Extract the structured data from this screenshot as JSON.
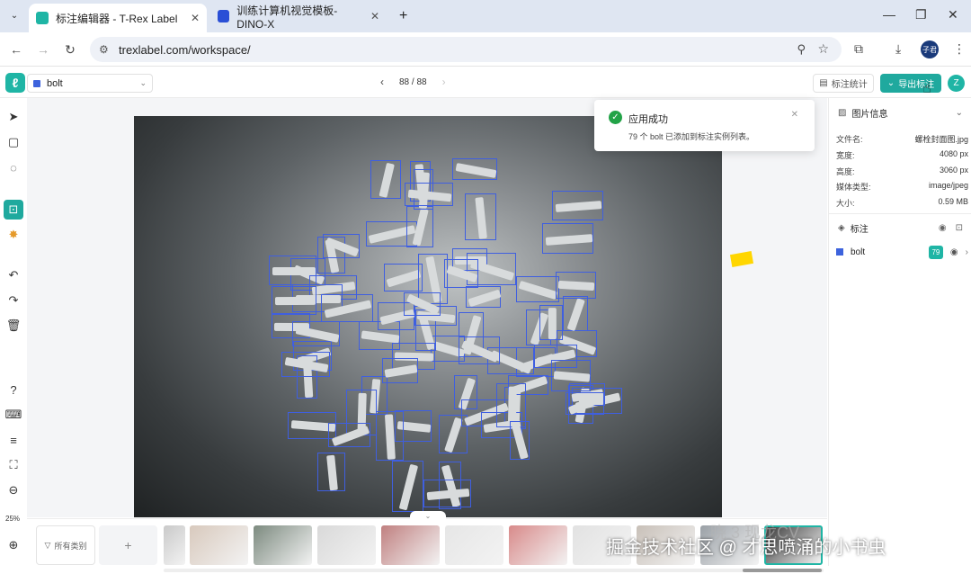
{
  "browser": {
    "tabs": [
      {
        "title": "标注编辑器 - T-Rex Label",
        "active": true
      },
      {
        "title": "训练计算机视觉模板- DINO-X",
        "active": false
      }
    ],
    "new_tab": "+",
    "url": "trexlabel.com/workspace/",
    "profile_initials": "子君"
  },
  "header": {
    "label_selector": "bolt",
    "pager": {
      "current": "88 / 88"
    },
    "stats_button": "标注统计",
    "export_button": "导出标注",
    "avatar_letter": "Z"
  },
  "toolbar": {
    "icons": [
      "select-arrow-icon",
      "rectangle-icon",
      "polygon-icon",
      "smart-box-icon",
      "magic-icon",
      "undo-icon",
      "redo-icon",
      "delete-icon",
      "help-icon",
      "keyboard-icon",
      "sliders-icon",
      "fit-icon",
      "zoom-out-icon",
      "zoom-in-icon"
    ],
    "zoom": "25%"
  },
  "toast": {
    "title": "应用成功",
    "message": "79 个 bolt 已添加到标注实例列表。"
  },
  "right_panel": {
    "image_info_title": "图片信息",
    "rows": [
      {
        "label": "文件名:",
        "value": "螺栓封面图.jpg"
      },
      {
        "label": "宽度:",
        "value": "4080 px"
      },
      {
        "label": "高度:",
        "value": "3060 px"
      },
      {
        "label": "媒体类型:",
        "value": "image/jpeg"
      },
      {
        "label": "大小:",
        "value": "0.59 MB"
      }
    ],
    "annotations_title": "标注",
    "annotation_item": {
      "label": "bolt",
      "count": "79"
    }
  },
  "filmstrip": {
    "filter_label": "所有类别",
    "add_label": "+",
    "collapse_label": "⌄",
    "thumbnails": 11
  },
  "watermark": "掘金技术社区 @ 才思喷涌的小书虫",
  "faint_logo": "晓 3   现龙CV",
  "colors": {
    "accent": "#1fa99e",
    "box": "#3f5fe0",
    "label_swatch": "#3d63dd",
    "success": "#22a347"
  }
}
